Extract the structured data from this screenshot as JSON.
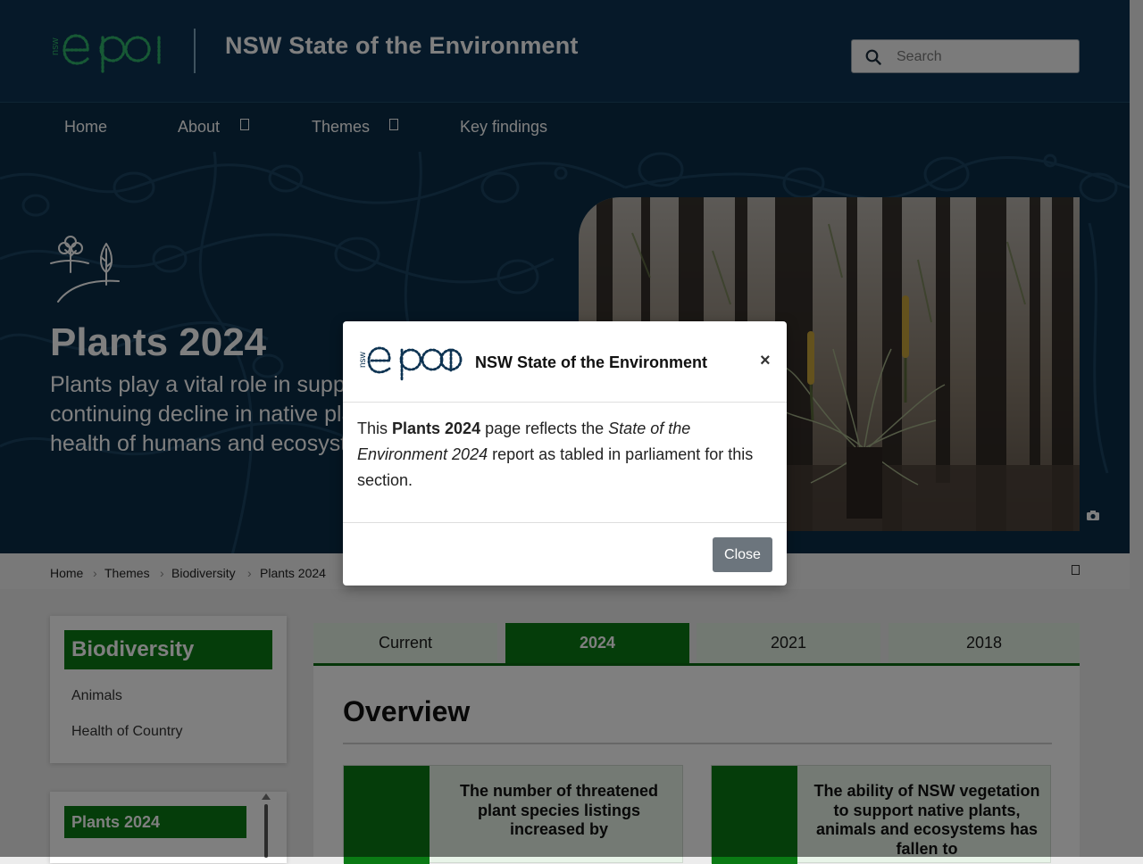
{
  "header": {
    "logo_text": "nsw epa",
    "site_title": "NSW State of the Environment",
    "search_placeholder": "Search"
  },
  "nav": {
    "items": [
      {
        "label": "Home",
        "has_dropdown": false
      },
      {
        "label": "About",
        "has_dropdown": true
      },
      {
        "label": "Themes",
        "has_dropdown": true
      },
      {
        "label": "Key findings",
        "has_dropdown": false
      }
    ]
  },
  "hero": {
    "icon": "trees-icon",
    "title": "Plants 2024",
    "description": "Plants play a vital role in supporting life on earth. The continuing decline in native plants threatens the health of humans and ecosystems.",
    "photo_alt": "Grass trees regrowing among burnt trees"
  },
  "breadcrumb": [
    "Home",
    "Themes",
    "Biodiversity",
    "Plants 2024"
  ],
  "sidebar": {
    "heading": "Biodiversity",
    "items": [
      "Animals",
      "Health of Country"
    ],
    "sub_heading": "Plants 2024"
  },
  "tabs": [
    {
      "label": "Current",
      "active": false
    },
    {
      "label": "2024",
      "active": true
    },
    {
      "label": "2021",
      "active": false
    },
    {
      "label": "2018",
      "active": false
    }
  ],
  "main": {
    "section_title": "Overview",
    "cards": [
      "The number of threatened plant species listings increased by",
      "The ability of NSW vegetation to support native plants, animals and ecosystems has fallen to"
    ]
  },
  "modal": {
    "title": "NSW State of the Environment",
    "body_prefix": "This ",
    "body_bold": "Plants 2024",
    "body_middle": " page reflects the ",
    "body_italic": "State of the Environment 2024",
    "body_suffix": " report as tabled in parliament for this section.",
    "close_label": "Close",
    "close_symbol": "×"
  },
  "colors": {
    "header_bg": "#0d3352",
    "accent_green": "#0a7a14",
    "tab_inactive": "#e4f2e4",
    "button_grey": "#6c757d"
  }
}
